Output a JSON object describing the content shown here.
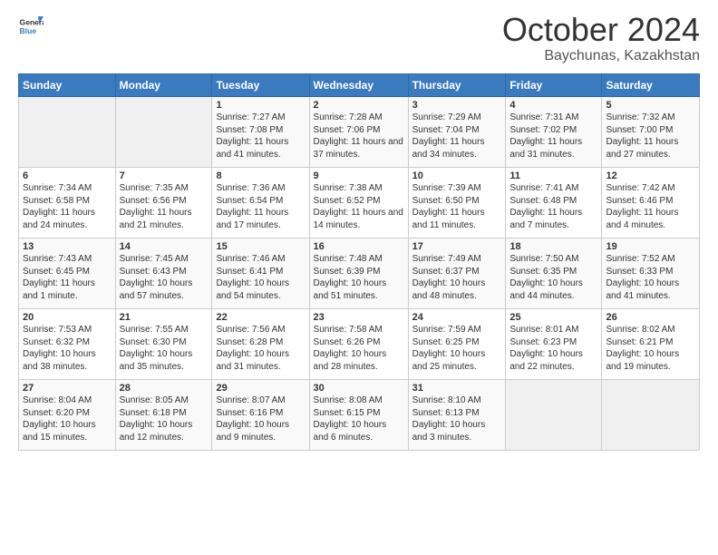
{
  "header": {
    "logo_general": "General",
    "logo_blue": "Blue",
    "month": "October 2024",
    "location": "Baychunas, Kazakhstan"
  },
  "days_of_week": [
    "Sunday",
    "Monday",
    "Tuesday",
    "Wednesday",
    "Thursday",
    "Friday",
    "Saturday"
  ],
  "weeks": [
    [
      {
        "day": "",
        "detail": ""
      },
      {
        "day": "",
        "detail": ""
      },
      {
        "day": "1",
        "detail": "Sunrise: 7:27 AM\nSunset: 7:08 PM\nDaylight: 11 hours and 41 minutes."
      },
      {
        "day": "2",
        "detail": "Sunrise: 7:28 AM\nSunset: 7:06 PM\nDaylight: 11 hours and 37 minutes."
      },
      {
        "day": "3",
        "detail": "Sunrise: 7:29 AM\nSunset: 7:04 PM\nDaylight: 11 hours and 34 minutes."
      },
      {
        "day": "4",
        "detail": "Sunrise: 7:31 AM\nSunset: 7:02 PM\nDaylight: 11 hours and 31 minutes."
      },
      {
        "day": "5",
        "detail": "Sunrise: 7:32 AM\nSunset: 7:00 PM\nDaylight: 11 hours and 27 minutes."
      }
    ],
    [
      {
        "day": "6",
        "detail": "Sunrise: 7:34 AM\nSunset: 6:58 PM\nDaylight: 11 hours and 24 minutes."
      },
      {
        "day": "7",
        "detail": "Sunrise: 7:35 AM\nSunset: 6:56 PM\nDaylight: 11 hours and 21 minutes."
      },
      {
        "day": "8",
        "detail": "Sunrise: 7:36 AM\nSunset: 6:54 PM\nDaylight: 11 hours and 17 minutes."
      },
      {
        "day": "9",
        "detail": "Sunrise: 7:38 AM\nSunset: 6:52 PM\nDaylight: 11 hours and 14 minutes."
      },
      {
        "day": "10",
        "detail": "Sunrise: 7:39 AM\nSunset: 6:50 PM\nDaylight: 11 hours and 11 minutes."
      },
      {
        "day": "11",
        "detail": "Sunrise: 7:41 AM\nSunset: 6:48 PM\nDaylight: 11 hours and 7 minutes."
      },
      {
        "day": "12",
        "detail": "Sunrise: 7:42 AM\nSunset: 6:46 PM\nDaylight: 11 hours and 4 minutes."
      }
    ],
    [
      {
        "day": "13",
        "detail": "Sunrise: 7:43 AM\nSunset: 6:45 PM\nDaylight: 11 hours and 1 minute."
      },
      {
        "day": "14",
        "detail": "Sunrise: 7:45 AM\nSunset: 6:43 PM\nDaylight: 10 hours and 57 minutes."
      },
      {
        "day": "15",
        "detail": "Sunrise: 7:46 AM\nSunset: 6:41 PM\nDaylight: 10 hours and 54 minutes."
      },
      {
        "day": "16",
        "detail": "Sunrise: 7:48 AM\nSunset: 6:39 PM\nDaylight: 10 hours and 51 minutes."
      },
      {
        "day": "17",
        "detail": "Sunrise: 7:49 AM\nSunset: 6:37 PM\nDaylight: 10 hours and 48 minutes."
      },
      {
        "day": "18",
        "detail": "Sunrise: 7:50 AM\nSunset: 6:35 PM\nDaylight: 10 hours and 44 minutes."
      },
      {
        "day": "19",
        "detail": "Sunrise: 7:52 AM\nSunset: 6:33 PM\nDaylight: 10 hours and 41 minutes."
      }
    ],
    [
      {
        "day": "20",
        "detail": "Sunrise: 7:53 AM\nSunset: 6:32 PM\nDaylight: 10 hours and 38 minutes."
      },
      {
        "day": "21",
        "detail": "Sunrise: 7:55 AM\nSunset: 6:30 PM\nDaylight: 10 hours and 35 minutes."
      },
      {
        "day": "22",
        "detail": "Sunrise: 7:56 AM\nSunset: 6:28 PM\nDaylight: 10 hours and 31 minutes."
      },
      {
        "day": "23",
        "detail": "Sunrise: 7:58 AM\nSunset: 6:26 PM\nDaylight: 10 hours and 28 minutes."
      },
      {
        "day": "24",
        "detail": "Sunrise: 7:59 AM\nSunset: 6:25 PM\nDaylight: 10 hours and 25 minutes."
      },
      {
        "day": "25",
        "detail": "Sunrise: 8:01 AM\nSunset: 6:23 PM\nDaylight: 10 hours and 22 minutes."
      },
      {
        "day": "26",
        "detail": "Sunrise: 8:02 AM\nSunset: 6:21 PM\nDaylight: 10 hours and 19 minutes."
      }
    ],
    [
      {
        "day": "27",
        "detail": "Sunrise: 8:04 AM\nSunset: 6:20 PM\nDaylight: 10 hours and 15 minutes."
      },
      {
        "day": "28",
        "detail": "Sunrise: 8:05 AM\nSunset: 6:18 PM\nDaylight: 10 hours and 12 minutes."
      },
      {
        "day": "29",
        "detail": "Sunrise: 8:07 AM\nSunset: 6:16 PM\nDaylight: 10 hours and 9 minutes."
      },
      {
        "day": "30",
        "detail": "Sunrise: 8:08 AM\nSunset: 6:15 PM\nDaylight: 10 hours and 6 minutes."
      },
      {
        "day": "31",
        "detail": "Sunrise: 8:10 AM\nSunset: 6:13 PM\nDaylight: 10 hours and 3 minutes."
      },
      {
        "day": "",
        "detail": ""
      },
      {
        "day": "",
        "detail": ""
      }
    ]
  ]
}
